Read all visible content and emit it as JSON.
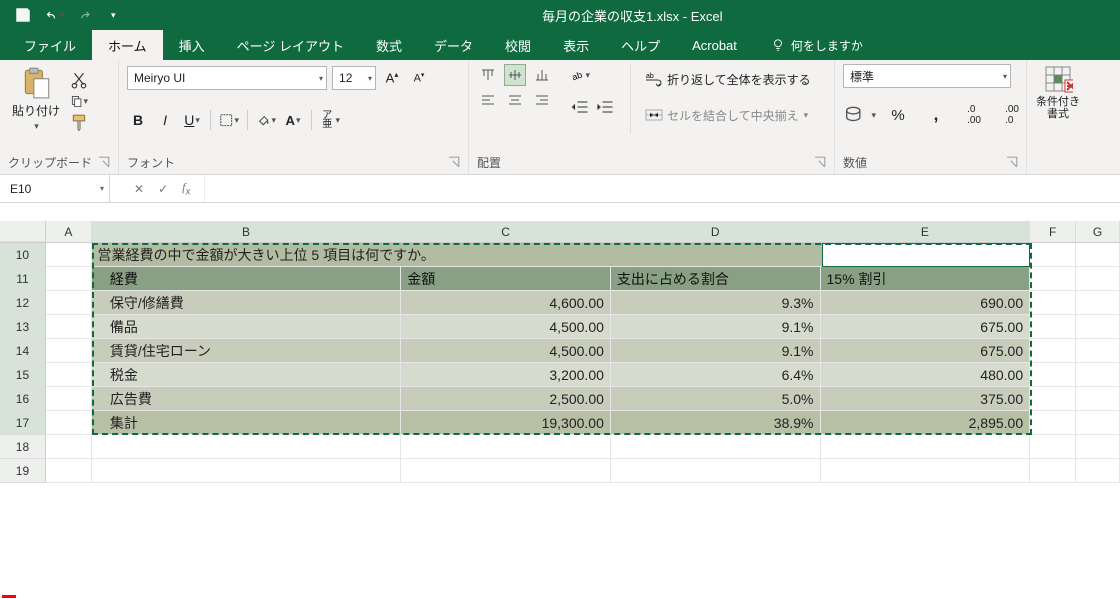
{
  "title": "毎月の企業の収支1.xlsx  -  Excel",
  "tabs": {
    "file": "ファイル",
    "home": "ホーム",
    "insert": "挿入",
    "pagelayout": "ページ レイアウト",
    "formulas": "数式",
    "data": "データ",
    "review": "校閲",
    "view": "表示",
    "help": "ヘルプ",
    "acrobat": "Acrobat"
  },
  "tellme": "何をしますか",
  "ribbon": {
    "clipboard": {
      "paste": "貼り付け",
      "label": "クリップボード"
    },
    "font": {
      "name": "Meiryo UI",
      "size": "12",
      "label": "フォント",
      "bold": "B",
      "italic": "I",
      "underline": "U",
      "ruby": "ア亜"
    },
    "alignment": {
      "label": "配置",
      "wrap": "折り返して全体を表示する",
      "merge": "セルを結合して中央揃え"
    },
    "number": {
      "format": "標準",
      "label": "数値"
    },
    "cf": {
      "label": "条件付き書式"
    }
  },
  "namebox": "E10",
  "cols": [
    "A",
    "B",
    "C",
    "D",
    "E",
    "F",
    "G"
  ],
  "rows": [
    "10",
    "11",
    "12",
    "13",
    "14",
    "15",
    "16",
    "17",
    "18",
    "19"
  ],
  "table": {
    "question": "営業経費の中で金額が大きい上位 5 項目は何ですか。",
    "headers": {
      "b": "経費",
      "c": "金額",
      "d": "支出に占める割合",
      "e": "15% 割引"
    },
    "r12": {
      "b": "保守/修繕費",
      "c": "4,600.00",
      "d": "9.3%",
      "e": "690.00"
    },
    "r13": {
      "b": "備品",
      "c": "4,500.00",
      "d": "9.1%",
      "e": "675.00"
    },
    "r14": {
      "b": "賃貸/住宅ローン",
      "c": "4,500.00",
      "d": "9.1%",
      "e": "675.00"
    },
    "r15": {
      "b": "税金",
      "c": "3,200.00",
      "d": "6.4%",
      "e": "480.00"
    },
    "r16": {
      "b": "広告費",
      "c": "2,500.00",
      "d": "5.0%",
      "e": "375.00"
    },
    "r17": {
      "b": "集計",
      "c": "19,300.00",
      "d": "38.9%",
      "e": "2,895.00"
    }
  },
  "chart_data": {
    "type": "table",
    "title": "営業経費の中で金額が大きい上位 5 項目は何ですか。",
    "columns": [
      "経費",
      "金額",
      "支出に占める割合",
      "15% 割引"
    ],
    "rows": [
      [
        "保守/修繕費",
        4600.0,
        0.093,
        690.0
      ],
      [
        "備品",
        4500.0,
        0.091,
        675.0
      ],
      [
        "賃貸/住宅ローン",
        4500.0,
        0.091,
        675.0
      ],
      [
        "税金",
        3200.0,
        0.064,
        480.0
      ],
      [
        "広告費",
        2500.0,
        0.05,
        375.0
      ]
    ],
    "totals": [
      "集計",
      19300.0,
      0.389,
      2895.0
    ]
  }
}
